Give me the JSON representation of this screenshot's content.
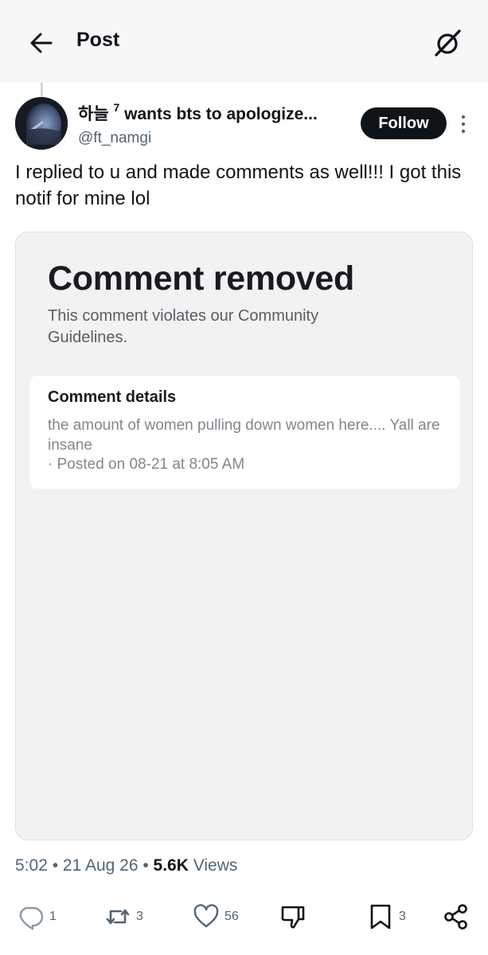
{
  "header": {
    "title": "Post"
  },
  "author": {
    "name": "하늘",
    "name_sup": "7",
    "name_rest": " wants bts to apologize...",
    "handle": "@ft_namgi",
    "follow_label": "Follow"
  },
  "tweet": {
    "text": "I replied to u and made comments as well!!! I got this notif for mine lol"
  },
  "media": {
    "title": "Comment removed",
    "description": "This comment violates our Community Guidelines.",
    "details_title": "Comment details",
    "details_body": "the amount of women pulling down women here.... Yall are insane",
    "details_posted": "· Posted on 08-21 at 8:05 AM"
  },
  "meta": {
    "time": "5:02",
    "sep1": " • ",
    "date": "21 Aug 26",
    "sep2": " • ",
    "views_count": "5.6K",
    "views_label": " Views"
  },
  "actions": {
    "replies": "1",
    "reposts": "3",
    "likes": "56",
    "bookmarks": "3"
  },
  "colors": {
    "text": "#0f1419",
    "secondary": "#536471",
    "header_bg": "#f7f7f7",
    "follow_bg": "#0f1419"
  }
}
